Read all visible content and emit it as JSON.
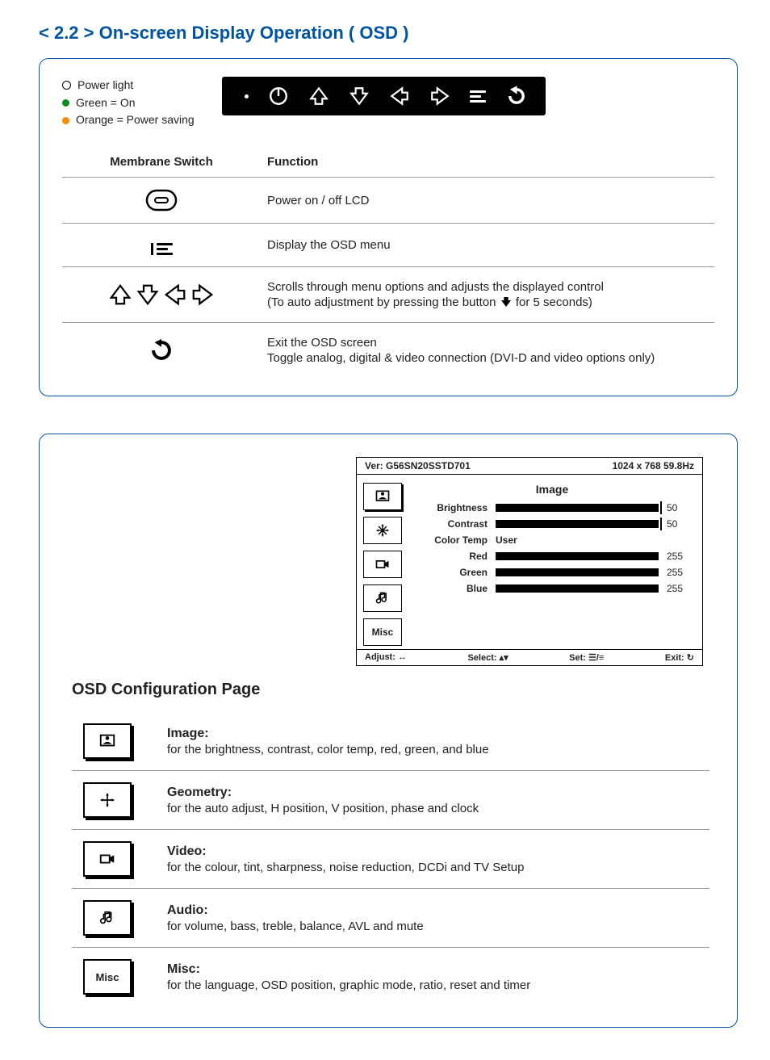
{
  "title": "< 2.2 > On-screen Display Operation ( OSD )",
  "legend": {
    "power_light": "Power light",
    "green_on": "Green = On",
    "orange_saving": "Orange = Power saving"
  },
  "switch_table": {
    "col_switch": "Membrane Switch",
    "col_function": "Function",
    "row_power": "Power on / off LCD",
    "row_menu": "Display the OSD menu",
    "row_arrows_a": "Scrolls through menu options and adjusts the displayed control",
    "row_arrows_b_pre": "(To auto adjustment by pressing the button ",
    "row_arrows_b_post": " for 5 seconds)",
    "row_exit_a": "Exit the OSD screen",
    "row_exit_b": "Toggle analog, digital & video connection (DVI-D and video options only)"
  },
  "osd": {
    "version_label": "Ver:",
    "version": "G56SN20SSTD701",
    "resolution": "1024 x 768  59.8Hz",
    "category": "Image",
    "items": {
      "brightness": {
        "label": "Brightness",
        "value": "50"
      },
      "contrast": {
        "label": "Contrast",
        "value": "50"
      },
      "colortemp": {
        "label": "Color Temp",
        "value": "User"
      },
      "red": {
        "label": "Red",
        "value": "255"
      },
      "green": {
        "label": "Green",
        "value": "255"
      },
      "blue": {
        "label": "Blue",
        "value": "255"
      }
    },
    "tabs": {
      "misc": "Misc"
    },
    "footer": {
      "adjust": "Adjust: ↔",
      "select": "Select: ▴▾",
      "set": "Set: ☰/≡",
      "exit": "Exit: ↻"
    }
  },
  "cfg_title": "OSD Configuration Page",
  "cfg": {
    "image": {
      "head": "Image:",
      "sub": "for the brightness, contrast, color temp, red, green, and blue"
    },
    "geometry": {
      "head": "Geometry:",
      "sub": "for the auto adjust, H position, V position, phase and clock"
    },
    "video": {
      "head": "Video:",
      "sub": "for the colour, tint, sharpness, noise reduction, DCDi and TV Setup"
    },
    "audio": {
      "head": "Audio:",
      "sub": "for volume, bass, treble, balance, AVL and mute"
    },
    "misc": {
      "head": "Misc:",
      "sub": "for the language, OSD position, graphic mode, ratio, reset and timer",
      "label": "Misc"
    }
  }
}
